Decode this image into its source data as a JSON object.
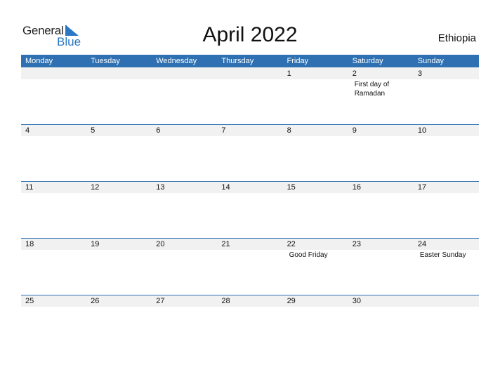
{
  "logo": {
    "text_general": "General",
    "text_blue": "Blue"
  },
  "title": "April 2022",
  "country": "Ethiopia",
  "colors": {
    "accent": "#2e70b1",
    "date_strip": "#f1f1f1",
    "logo_blue": "#2a77c4"
  },
  "weekdays": [
    "Monday",
    "Tuesday",
    "Wednesday",
    "Thursday",
    "Friday",
    "Saturday",
    "Sunday"
  ],
  "weeks": [
    [
      {
        "day": ""
      },
      {
        "day": ""
      },
      {
        "day": ""
      },
      {
        "day": ""
      },
      {
        "day": "1"
      },
      {
        "day": "2",
        "event": "First day of Ramadan"
      },
      {
        "day": "3"
      }
    ],
    [
      {
        "day": "4"
      },
      {
        "day": "5"
      },
      {
        "day": "6"
      },
      {
        "day": "7"
      },
      {
        "day": "8"
      },
      {
        "day": "9"
      },
      {
        "day": "10"
      }
    ],
    [
      {
        "day": "11"
      },
      {
        "day": "12"
      },
      {
        "day": "13"
      },
      {
        "day": "14"
      },
      {
        "day": "15"
      },
      {
        "day": "16"
      },
      {
        "day": "17"
      }
    ],
    [
      {
        "day": "18"
      },
      {
        "day": "19"
      },
      {
        "day": "20"
      },
      {
        "day": "21"
      },
      {
        "day": "22",
        "event": "Good Friday"
      },
      {
        "day": "23"
      },
      {
        "day": "24",
        "event": "Easter Sunday"
      }
    ],
    [
      {
        "day": "25"
      },
      {
        "day": "26"
      },
      {
        "day": "27"
      },
      {
        "day": "28"
      },
      {
        "day": "29"
      },
      {
        "day": "30"
      },
      {
        "day": ""
      }
    ]
  ]
}
